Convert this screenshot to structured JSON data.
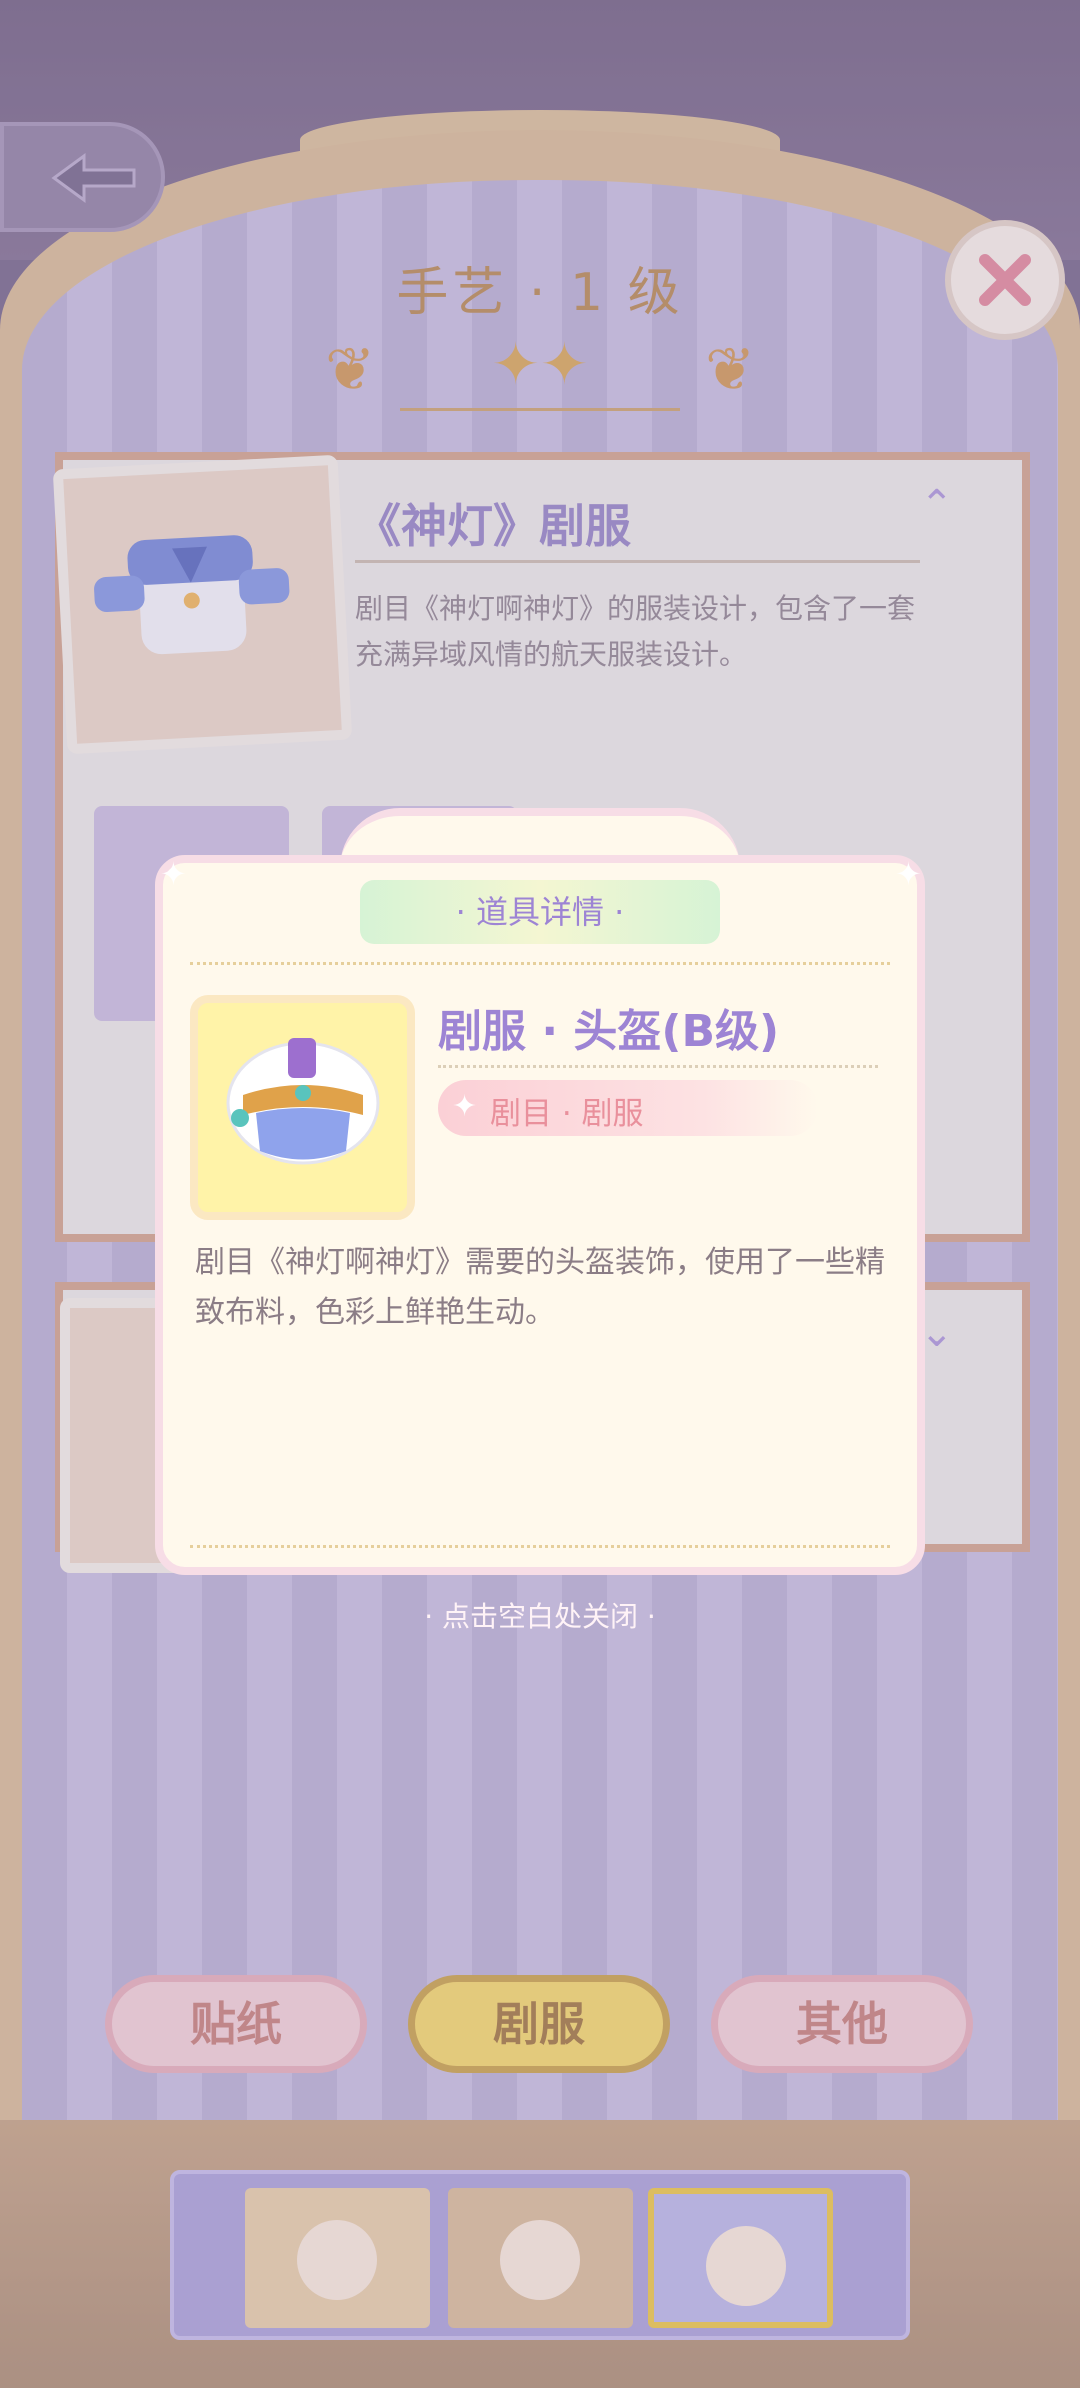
{
  "header": {
    "level_title": "手艺 · 1 级",
    "stars": "✦✦"
  },
  "card1": {
    "title": "《神灯》剧服",
    "description": "剧目《神灯啊神灯》的服装设计，包含了一套充满异域风情的航天服装设计。"
  },
  "popup": {
    "header": "· 道具详情 ·",
    "item_name": "剧服 · 头盔(B级)",
    "tag": "剧目 · 剧服",
    "description": "剧目《神灯啊神灯》需要的头盔装饰，使用了一些精致布料，色彩上鲜艳生动。",
    "close_hint": "· 点击空白处关闭 ·"
  },
  "categories": [
    {
      "label": "贴纸",
      "selected": false
    },
    {
      "label": "剧服",
      "selected": true
    },
    {
      "label": "其他",
      "selected": false
    }
  ],
  "colors": {
    "accent_purple": "#9d84d4",
    "selected_yellow": "#f5d55e",
    "frame_gold": "#d7b58d"
  },
  "icons": {
    "back": "diamond-arrow-icon",
    "close": "close-x-icon",
    "collapse": "chevron-up-icon",
    "expand": "chevron-down-icon"
  }
}
